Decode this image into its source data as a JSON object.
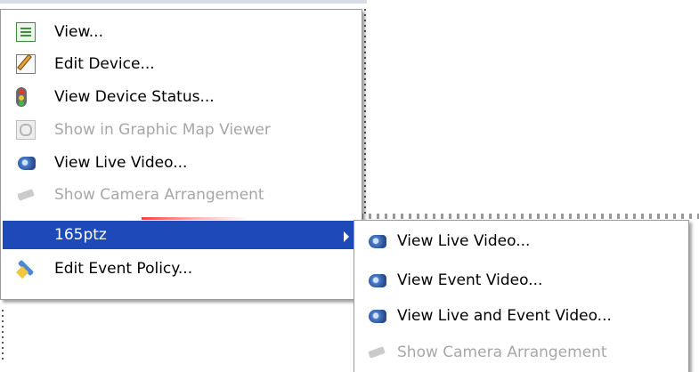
{
  "main_menu": {
    "items": [
      {
        "label": "View...",
        "icon": "view-list-icon",
        "enabled": true
      },
      {
        "label": "Edit Device...",
        "icon": "edit-device-icon",
        "enabled": true
      },
      {
        "label": "View Device Status...",
        "icon": "traffic-light-icon",
        "enabled": true
      },
      {
        "label": "Show in Graphic Map Viewer",
        "icon": "map-magnifier-icon",
        "enabled": false
      },
      {
        "label": "View Live Video...",
        "icon": "camera-icon",
        "enabled": true
      },
      {
        "label": "Show Camera Arrangement",
        "icon": "camera-arrangement-icon",
        "enabled": false
      },
      {
        "label": "165ptz",
        "icon": "",
        "enabled": true,
        "selected": true,
        "has_submenu": true
      },
      {
        "label": "Edit Event Policy...",
        "icon": "event-policy-icon",
        "enabled": true
      }
    ]
  },
  "sub_menu": {
    "items": [
      {
        "label": "View Live Video...",
        "icon": "camera-icon",
        "enabled": true
      },
      {
        "label": "View Event Video...",
        "icon": "camera-icon",
        "enabled": true
      },
      {
        "label": "View Live and Event Video...",
        "icon": "camera-icon",
        "enabled": true
      },
      {
        "label": "Show Camera Arrangement",
        "icon": "camera-arrangement-icon",
        "enabled": false
      }
    ]
  },
  "colors": {
    "selection": "#1d49b9",
    "disabled_text": "#a7a7a7"
  }
}
